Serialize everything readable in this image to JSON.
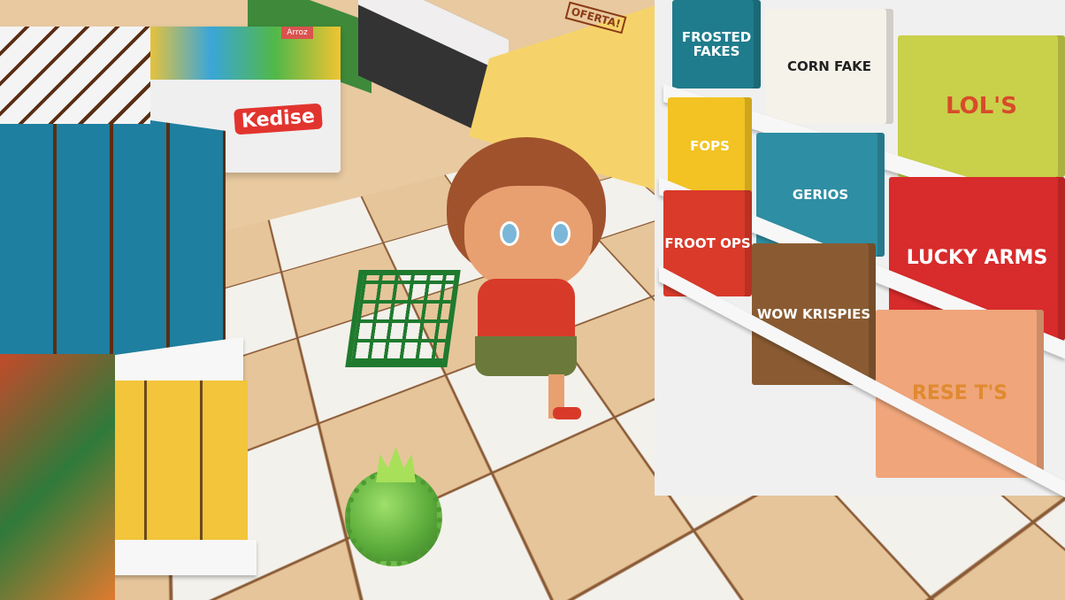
{
  "scene": {
    "promo_freezer": {
      "brand": "Kedise",
      "color": "#e2342f"
    },
    "sign_top": "Arroz",
    "bakery_tag": "OFERTA!",
    "cereal_boxes": [
      {
        "label": "FROSTED FAKES",
        "color": "#1f7c8c"
      },
      {
        "label": "CORN FAKE",
        "color": "#f5f2ea"
      },
      {
        "label": "LOL'S",
        "color": "#c9d04a"
      },
      {
        "label": "FOPS",
        "color": "#f2c323"
      },
      {
        "label": "GERIOS",
        "color": "#2e8ea3"
      },
      {
        "label": "LUCKY ARMS",
        "color": "#d82b2b"
      },
      {
        "label": "FROOT OPS",
        "color": "#d93a2a"
      },
      {
        "label": "WOW KRISPIES",
        "color": "#8a5b32"
      },
      {
        "label": "RESE T'S",
        "color": "#f0a57a"
      }
    ],
    "colors": {
      "left_shelf_top": "#1f8aa8",
      "left_shelf_bottom": "#f2c53a",
      "basket": "#1f7a2e",
      "virus": "#6cc04a",
      "shirt": "#d83a2a"
    }
  }
}
